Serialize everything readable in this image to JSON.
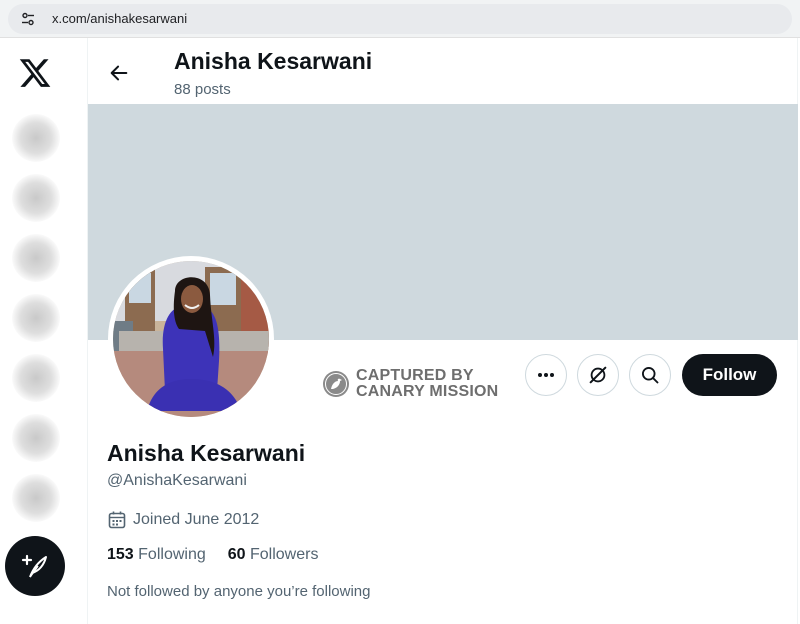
{
  "browser": {
    "url": "x.com/anishakesarwani"
  },
  "nav": {
    "logo": "x-logo-icon",
    "items": [
      "home-icon",
      "explore-icon",
      "notifications-icon",
      "messages-icon",
      "bookmarks-icon",
      "profile-icon",
      "more-icon"
    ],
    "compose": "compose-icon"
  },
  "header": {
    "name": "Anisha Kesarwani",
    "posts": "88 posts"
  },
  "watermark": {
    "line1": "CAPTURED BY",
    "line2": "CANARY MISSION"
  },
  "actions": {
    "follow_label": "Follow"
  },
  "profile": {
    "name": "Anisha Kesarwani",
    "handle": "@AnishaKesarwani",
    "joined": "Joined June 2012",
    "following_count": "153",
    "following_label": "Following",
    "followers_count": "60",
    "followers_label": "Followers",
    "not_followed": "Not followed by anyone you’re following"
  },
  "colors": {
    "banner": "#cfd9de",
    "primary_text": "#0f1419",
    "secondary_text": "#536471",
    "follow_bg": "#0f1419"
  }
}
